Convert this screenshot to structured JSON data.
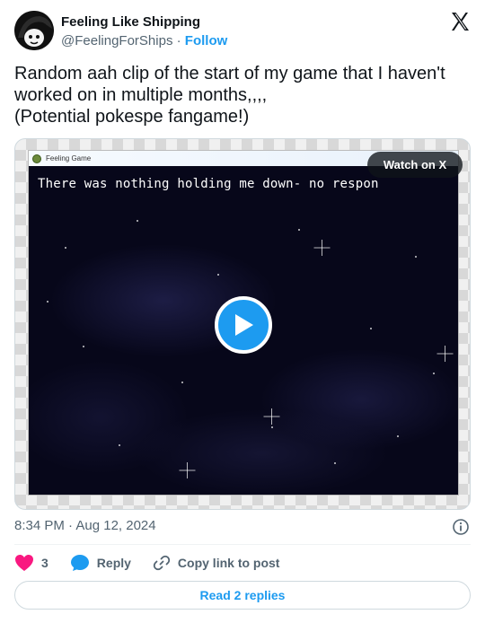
{
  "author": {
    "display_name": "Feeling Like Shipping",
    "handle": "@FeelingForShips",
    "separator": "·",
    "follow_label": "Follow"
  },
  "tweet": {
    "text": "Random aah clip of the start of my game that I haven't worked on in multiple months,,,,\n(Potential pokespe fangame!)"
  },
  "media": {
    "window_title": "Feeling Game",
    "dialog_text": "There was nothing holding me down- no respon",
    "watch_label": "Watch on X"
  },
  "meta": {
    "timestamp": "8:34 PM · Aug 12, 2024"
  },
  "actions": {
    "like_count": "3",
    "reply_label": "Reply",
    "copy_label": "Copy link to post"
  },
  "replies_button": "Read 2 replies",
  "colors": {
    "accent": "#1d9bf0",
    "like": "#f91880",
    "muted": "#536471"
  },
  "icons": [
    "x-logo-icon",
    "play-icon",
    "heart-icon",
    "reply-bubble-icon",
    "link-icon",
    "info-icon"
  ]
}
